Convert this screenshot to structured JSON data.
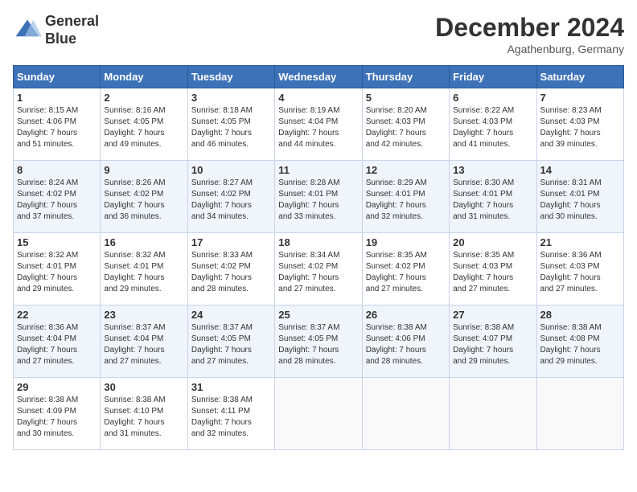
{
  "header": {
    "logo_line1": "General",
    "logo_line2": "Blue",
    "month": "December 2024",
    "location": "Agathenburg, Germany"
  },
  "weekdays": [
    "Sunday",
    "Monday",
    "Tuesday",
    "Wednesday",
    "Thursday",
    "Friday",
    "Saturday"
  ],
  "weeks": [
    [
      {
        "day": "1",
        "lines": [
          "Sunrise: 8:15 AM",
          "Sunset: 4:06 PM",
          "Daylight: 7 hours",
          "and 51 minutes."
        ]
      },
      {
        "day": "2",
        "lines": [
          "Sunrise: 8:16 AM",
          "Sunset: 4:05 PM",
          "Daylight: 7 hours",
          "and 49 minutes."
        ]
      },
      {
        "day": "3",
        "lines": [
          "Sunrise: 8:18 AM",
          "Sunset: 4:05 PM",
          "Daylight: 7 hours",
          "and 46 minutes."
        ]
      },
      {
        "day": "4",
        "lines": [
          "Sunrise: 8:19 AM",
          "Sunset: 4:04 PM",
          "Daylight: 7 hours",
          "and 44 minutes."
        ]
      },
      {
        "day": "5",
        "lines": [
          "Sunrise: 8:20 AM",
          "Sunset: 4:03 PM",
          "Daylight: 7 hours",
          "and 42 minutes."
        ]
      },
      {
        "day": "6",
        "lines": [
          "Sunrise: 8:22 AM",
          "Sunset: 4:03 PM",
          "Daylight: 7 hours",
          "and 41 minutes."
        ]
      },
      {
        "day": "7",
        "lines": [
          "Sunrise: 8:23 AM",
          "Sunset: 4:03 PM",
          "Daylight: 7 hours",
          "and 39 minutes."
        ]
      }
    ],
    [
      {
        "day": "8",
        "lines": [
          "Sunrise: 8:24 AM",
          "Sunset: 4:02 PM",
          "Daylight: 7 hours",
          "and 37 minutes."
        ]
      },
      {
        "day": "9",
        "lines": [
          "Sunrise: 8:26 AM",
          "Sunset: 4:02 PM",
          "Daylight: 7 hours",
          "and 36 minutes."
        ]
      },
      {
        "day": "10",
        "lines": [
          "Sunrise: 8:27 AM",
          "Sunset: 4:02 PM",
          "Daylight: 7 hours",
          "and 34 minutes."
        ]
      },
      {
        "day": "11",
        "lines": [
          "Sunrise: 8:28 AM",
          "Sunset: 4:01 PM",
          "Daylight: 7 hours",
          "and 33 minutes."
        ]
      },
      {
        "day": "12",
        "lines": [
          "Sunrise: 8:29 AM",
          "Sunset: 4:01 PM",
          "Daylight: 7 hours",
          "and 32 minutes."
        ]
      },
      {
        "day": "13",
        "lines": [
          "Sunrise: 8:30 AM",
          "Sunset: 4:01 PM",
          "Daylight: 7 hours",
          "and 31 minutes."
        ]
      },
      {
        "day": "14",
        "lines": [
          "Sunrise: 8:31 AM",
          "Sunset: 4:01 PM",
          "Daylight: 7 hours",
          "and 30 minutes."
        ]
      }
    ],
    [
      {
        "day": "15",
        "lines": [
          "Sunrise: 8:32 AM",
          "Sunset: 4:01 PM",
          "Daylight: 7 hours",
          "and 29 minutes."
        ]
      },
      {
        "day": "16",
        "lines": [
          "Sunrise: 8:32 AM",
          "Sunset: 4:01 PM",
          "Daylight: 7 hours",
          "and 29 minutes."
        ]
      },
      {
        "day": "17",
        "lines": [
          "Sunrise: 8:33 AM",
          "Sunset: 4:02 PM",
          "Daylight: 7 hours",
          "and 28 minutes."
        ]
      },
      {
        "day": "18",
        "lines": [
          "Sunrise: 8:34 AM",
          "Sunset: 4:02 PM",
          "Daylight: 7 hours",
          "and 27 minutes."
        ]
      },
      {
        "day": "19",
        "lines": [
          "Sunrise: 8:35 AM",
          "Sunset: 4:02 PM",
          "Daylight: 7 hours",
          "and 27 minutes."
        ]
      },
      {
        "day": "20",
        "lines": [
          "Sunrise: 8:35 AM",
          "Sunset: 4:03 PM",
          "Daylight: 7 hours",
          "and 27 minutes."
        ]
      },
      {
        "day": "21",
        "lines": [
          "Sunrise: 8:36 AM",
          "Sunset: 4:03 PM",
          "Daylight: 7 hours",
          "and 27 minutes."
        ]
      }
    ],
    [
      {
        "day": "22",
        "lines": [
          "Sunrise: 8:36 AM",
          "Sunset: 4:04 PM",
          "Daylight: 7 hours",
          "and 27 minutes."
        ]
      },
      {
        "day": "23",
        "lines": [
          "Sunrise: 8:37 AM",
          "Sunset: 4:04 PM",
          "Daylight: 7 hours",
          "and 27 minutes."
        ]
      },
      {
        "day": "24",
        "lines": [
          "Sunrise: 8:37 AM",
          "Sunset: 4:05 PM",
          "Daylight: 7 hours",
          "and 27 minutes."
        ]
      },
      {
        "day": "25",
        "lines": [
          "Sunrise: 8:37 AM",
          "Sunset: 4:05 PM",
          "Daylight: 7 hours",
          "and 28 minutes."
        ]
      },
      {
        "day": "26",
        "lines": [
          "Sunrise: 8:38 AM",
          "Sunset: 4:06 PM",
          "Daylight: 7 hours",
          "and 28 minutes."
        ]
      },
      {
        "day": "27",
        "lines": [
          "Sunrise: 8:38 AM",
          "Sunset: 4:07 PM",
          "Daylight: 7 hours",
          "and 29 minutes."
        ]
      },
      {
        "day": "28",
        "lines": [
          "Sunrise: 8:38 AM",
          "Sunset: 4:08 PM",
          "Daylight: 7 hours",
          "and 29 minutes."
        ]
      }
    ],
    [
      {
        "day": "29",
        "lines": [
          "Sunrise: 8:38 AM",
          "Sunset: 4:09 PM",
          "Daylight: 7 hours",
          "and 30 minutes."
        ]
      },
      {
        "day": "30",
        "lines": [
          "Sunrise: 8:38 AM",
          "Sunset: 4:10 PM",
          "Daylight: 7 hours",
          "and 31 minutes."
        ]
      },
      {
        "day": "31",
        "lines": [
          "Sunrise: 8:38 AM",
          "Sunset: 4:11 PM",
          "Daylight: 7 hours",
          "and 32 minutes."
        ]
      },
      null,
      null,
      null,
      null
    ]
  ]
}
